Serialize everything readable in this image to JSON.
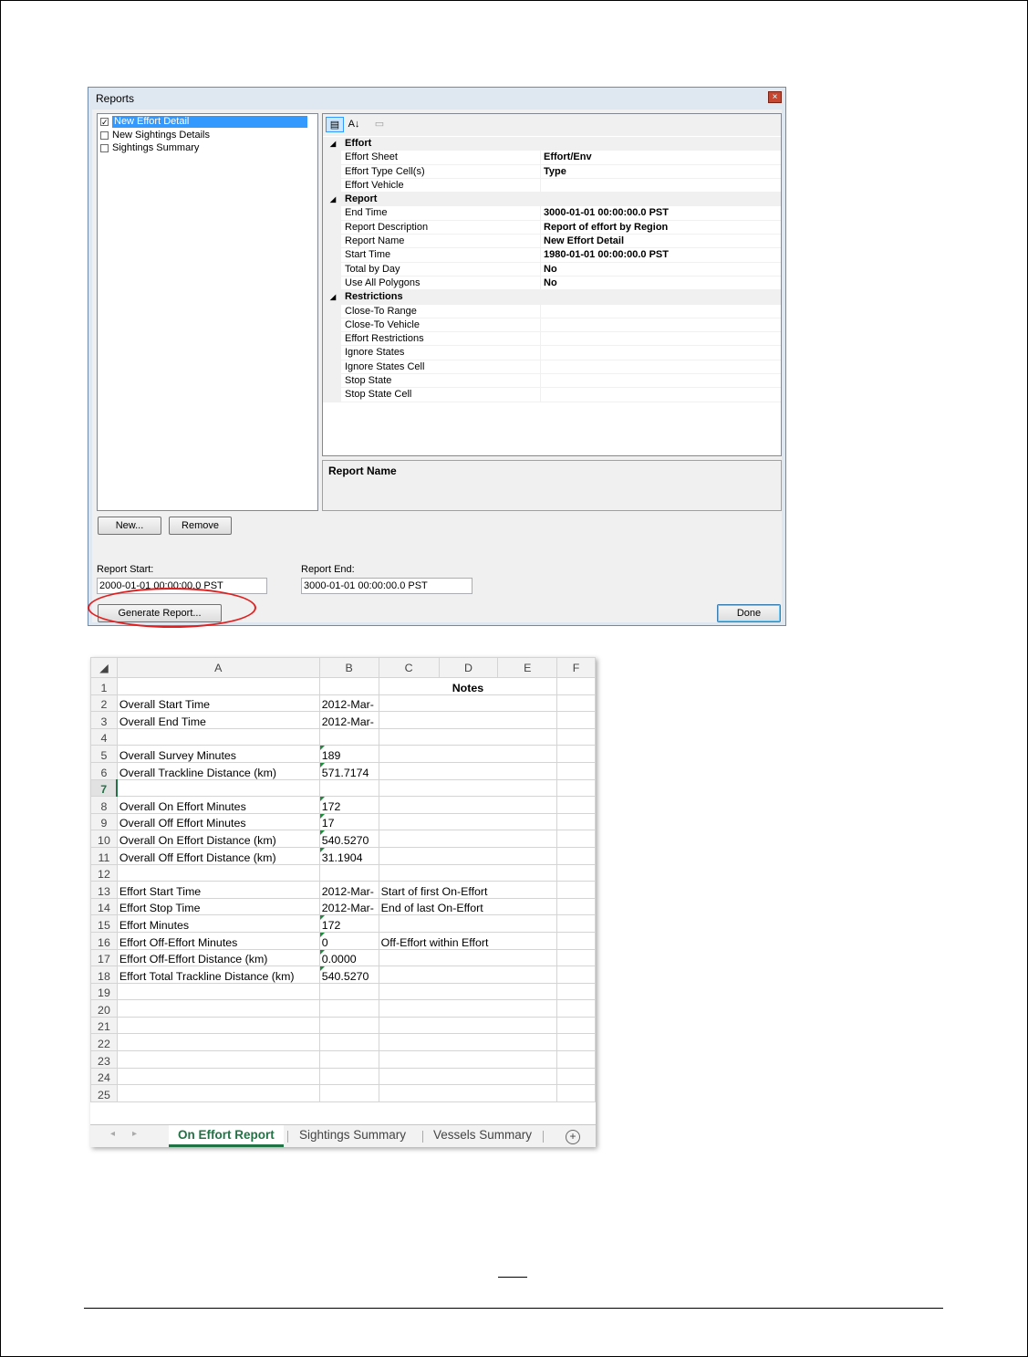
{
  "dialog": {
    "title": "Reports",
    "close_label": "×",
    "report_list": [
      {
        "label": "New Effort Detail",
        "checked": true,
        "selected": true
      },
      {
        "label": "New Sightings Details",
        "checked": false,
        "selected": false
      },
      {
        "label": "Sightings Summary",
        "checked": false,
        "selected": false
      }
    ],
    "toolbar": {
      "categorized_icon": "categorized-view-icon",
      "alphabetical_icon": "alphabetical-sort-icon",
      "pages_icon": "property-pages-icon"
    },
    "property_groups": [
      {
        "name": "Effort",
        "props": [
          {
            "name": "Effort Sheet",
            "value": "Effort/Env"
          },
          {
            "name": "Effort Type Cell(s)",
            "value": "Type"
          },
          {
            "name": "Effort Vehicle",
            "value": ""
          }
        ]
      },
      {
        "name": "Report",
        "props": [
          {
            "name": "End Time",
            "value": "3000-01-01 00:00:00.0 PST"
          },
          {
            "name": "Report Description",
            "value": "Report of effort by Region"
          },
          {
            "name": "Report Name",
            "value": "New Effort Detail"
          },
          {
            "name": "Start Time",
            "value": "1980-01-01 00:00:00.0 PST"
          },
          {
            "name": "Total by Day",
            "value": "No"
          },
          {
            "name": "Use All Polygons",
            "value": "No"
          }
        ]
      },
      {
        "name": "Restrictions",
        "props": [
          {
            "name": "Close-To Range",
            "value": ""
          },
          {
            "name": "Close-To Vehicle",
            "value": ""
          },
          {
            "name": "Effort Restrictions",
            "value": ""
          },
          {
            "name": "Ignore States",
            "value": ""
          },
          {
            "name": "Ignore States Cell",
            "value": ""
          },
          {
            "name": "Stop State",
            "value": ""
          },
          {
            "name": "Stop State Cell",
            "value": ""
          }
        ]
      }
    ],
    "description_title": "Report Name",
    "new_button": "New...",
    "remove_button": "Remove",
    "report_start_label": "Report Start:",
    "report_start_value": "2000-01-01 00:00:00.0 PST",
    "report_end_label": "Report End:",
    "report_end_value": "3000-01-01 00:00:00.0 PST",
    "generate_button": "Generate Report...",
    "done_button": "Done"
  },
  "spreadsheet": {
    "columns": [
      "A",
      "B",
      "C",
      "D",
      "E",
      "F"
    ],
    "active_row": 7,
    "rows": [
      {
        "n": "1",
        "a": "",
        "b": "",
        "c": "Notes",
        "tri": false
      },
      {
        "n": "2",
        "a": "Overall Start Time",
        "b": "2012-Mar-",
        "c": "",
        "tri": false
      },
      {
        "n": "3",
        "a": "Overall End Time",
        "b": "2012-Mar-",
        "c": "",
        "tri": false
      },
      {
        "n": "4",
        "a": "",
        "b": "",
        "c": "",
        "tri": false
      },
      {
        "n": "5",
        "a": "Overall Survey Minutes",
        "b": "189",
        "c": "",
        "tri": true
      },
      {
        "n": "6",
        "a": "Overall Trackline Distance (km)",
        "b": "571.7174",
        "c": "",
        "tri": true
      },
      {
        "n": "7",
        "a": "",
        "b": "",
        "c": "",
        "tri": false
      },
      {
        "n": "8",
        "a": "Overall On Effort Minutes",
        "b": "172",
        "c": "",
        "tri": true
      },
      {
        "n": "9",
        "a": "Overall Off Effort Minutes",
        "b": "17",
        "c": "",
        "tri": true
      },
      {
        "n": "10",
        "a": "Overall On Effort Distance (km)",
        "b": "540.5270",
        "c": "",
        "tri": true
      },
      {
        "n": "11",
        "a": "Overall Off Effort Distance (km)",
        "b": "31.1904",
        "c": "",
        "tri": true
      },
      {
        "n": "12",
        "a": "",
        "b": "",
        "c": "",
        "tri": false
      },
      {
        "n": "13",
        "a": "Effort Start Time",
        "b": "2012-Mar-",
        "c": "Start of first On-Effort",
        "tri": false
      },
      {
        "n": "14",
        "a": "Effort Stop Time",
        "b": "2012-Mar-",
        "c": "End of last On-Effort",
        "tri": false
      },
      {
        "n": "15",
        "a": "Effort Minutes",
        "b": "172",
        "c": "",
        "tri": true
      },
      {
        "n": "16",
        "a": "Effort Off-Effort Minutes",
        "b": "0",
        "c": "Off-Effort within Effort",
        "tri": true
      },
      {
        "n": "17",
        "a": "Effort Off-Effort Distance (km)",
        "b": "0.0000",
        "c": "",
        "tri": true
      },
      {
        "n": "18",
        "a": "Effort Total Trackline Distance (km)",
        "b": "540.5270",
        "c": "",
        "tri": true
      },
      {
        "n": "19",
        "a": "",
        "b": "",
        "c": "",
        "tri": false
      },
      {
        "n": "20",
        "a": "",
        "b": "",
        "c": "",
        "tri": false
      },
      {
        "n": "21",
        "a": "",
        "b": "",
        "c": "",
        "tri": false
      },
      {
        "n": "22",
        "a": "",
        "b": "",
        "c": "",
        "tri": false
      },
      {
        "n": "23",
        "a": "",
        "b": "",
        "c": "",
        "tri": false
      },
      {
        "n": "24",
        "a": "",
        "b": "",
        "c": "",
        "tri": false
      },
      {
        "n": "25",
        "a": "",
        "b": "",
        "c": "",
        "tri": false
      }
    ],
    "sheet_tabs": [
      {
        "label": "On Effort Report",
        "active": true
      },
      {
        "label": "Sightings Summary",
        "active": false
      },
      {
        "label": "Vessels Summary",
        "active": false
      }
    ],
    "add_sheet_label": "+",
    "nav_prev": "◂",
    "nav_next": "▸"
  },
  "colors": {
    "excel_green": "#217346",
    "selection_blue": "#3399ff",
    "annotation_red": "#e02020"
  }
}
